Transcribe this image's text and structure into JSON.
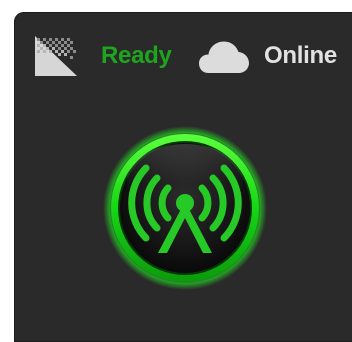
{
  "status": {
    "signal_icon": "signal-strength-icon",
    "ready_label": "Ready",
    "cloud_icon": "cloud-icon",
    "online_label": "Online"
  },
  "broadcast": {
    "icon": "broadcast-antenna-icon"
  },
  "colors": {
    "panel_background": "#2a2a2a",
    "ready_text": "#1ea51e",
    "online_text": "#e0e0e0",
    "icon_gray": "#d8d8d8",
    "accent_green": "#22c322",
    "ring_outer": "#10ff10",
    "button_dark": "#141414"
  }
}
